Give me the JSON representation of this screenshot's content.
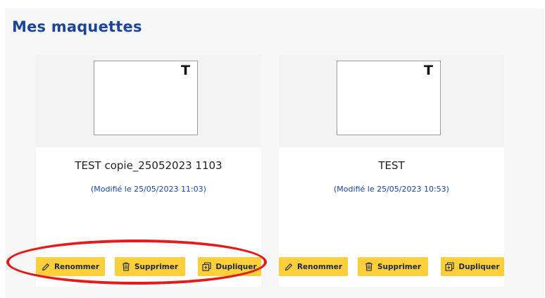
{
  "page": {
    "title": "Mes maquettes"
  },
  "cards": [
    {
      "thumb_letter": "T",
      "name": "TEST copie_25052023 1103",
      "modified": "(Modifié le 25/05/2023 11:03)",
      "actions": {
        "rename": "Renommer",
        "delete": "Supprimer",
        "duplicate": "Dupliquer"
      }
    },
    {
      "thumb_letter": "T",
      "name": "TEST",
      "modified": "(Modifié le 25/05/2023 10:53)",
      "actions": {
        "rename": "Renommer",
        "delete": "Supprimer",
        "duplicate": "Dupliquer"
      }
    }
  ],
  "icons": {
    "rename": "pencil-icon",
    "delete": "trash-icon",
    "duplicate": "duplicate-icon"
  },
  "colors": {
    "title": "#1b4596",
    "button": "#fecf3a",
    "annotation": "#e41b1b"
  }
}
